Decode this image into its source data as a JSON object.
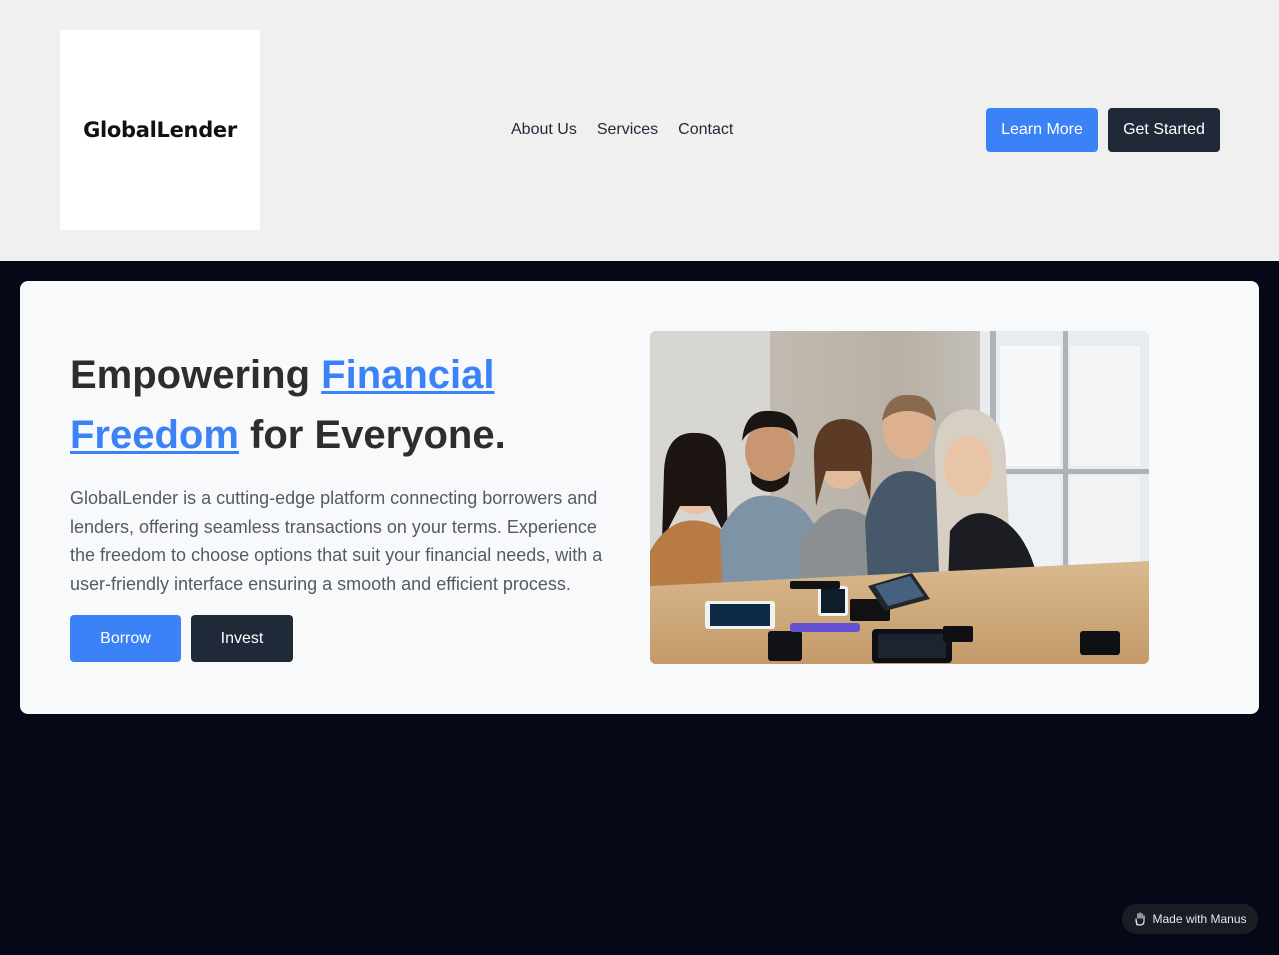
{
  "header": {
    "logo_text": "GlobalLender",
    "nav": [
      {
        "label": "About Us"
      },
      {
        "label": "Services"
      },
      {
        "label": "Contact"
      }
    ],
    "learn_more_label": "Learn More",
    "get_started_label": "Get Started"
  },
  "hero": {
    "title_part1": "Empowering ",
    "title_highlight": "Financial Freedom",
    "title_part2": " for Everyone.",
    "description": "GlobalLender is a cutting-edge platform connecting borrowers and lenders, offering seamless transactions on your terms. Experience the freedom to choose options that suit your financial needs, with a user-friendly interface ensuring a smooth and efficient process.",
    "borrow_label": "Borrow",
    "invest_label": "Invest"
  },
  "badge": {
    "label": "Made with Manus",
    "icon": "manus-hand-icon"
  },
  "colors": {
    "accent": "#3b82f6",
    "dark_button": "#1f2937",
    "page_background": "#050816",
    "header_background": "#f0f0f0"
  }
}
